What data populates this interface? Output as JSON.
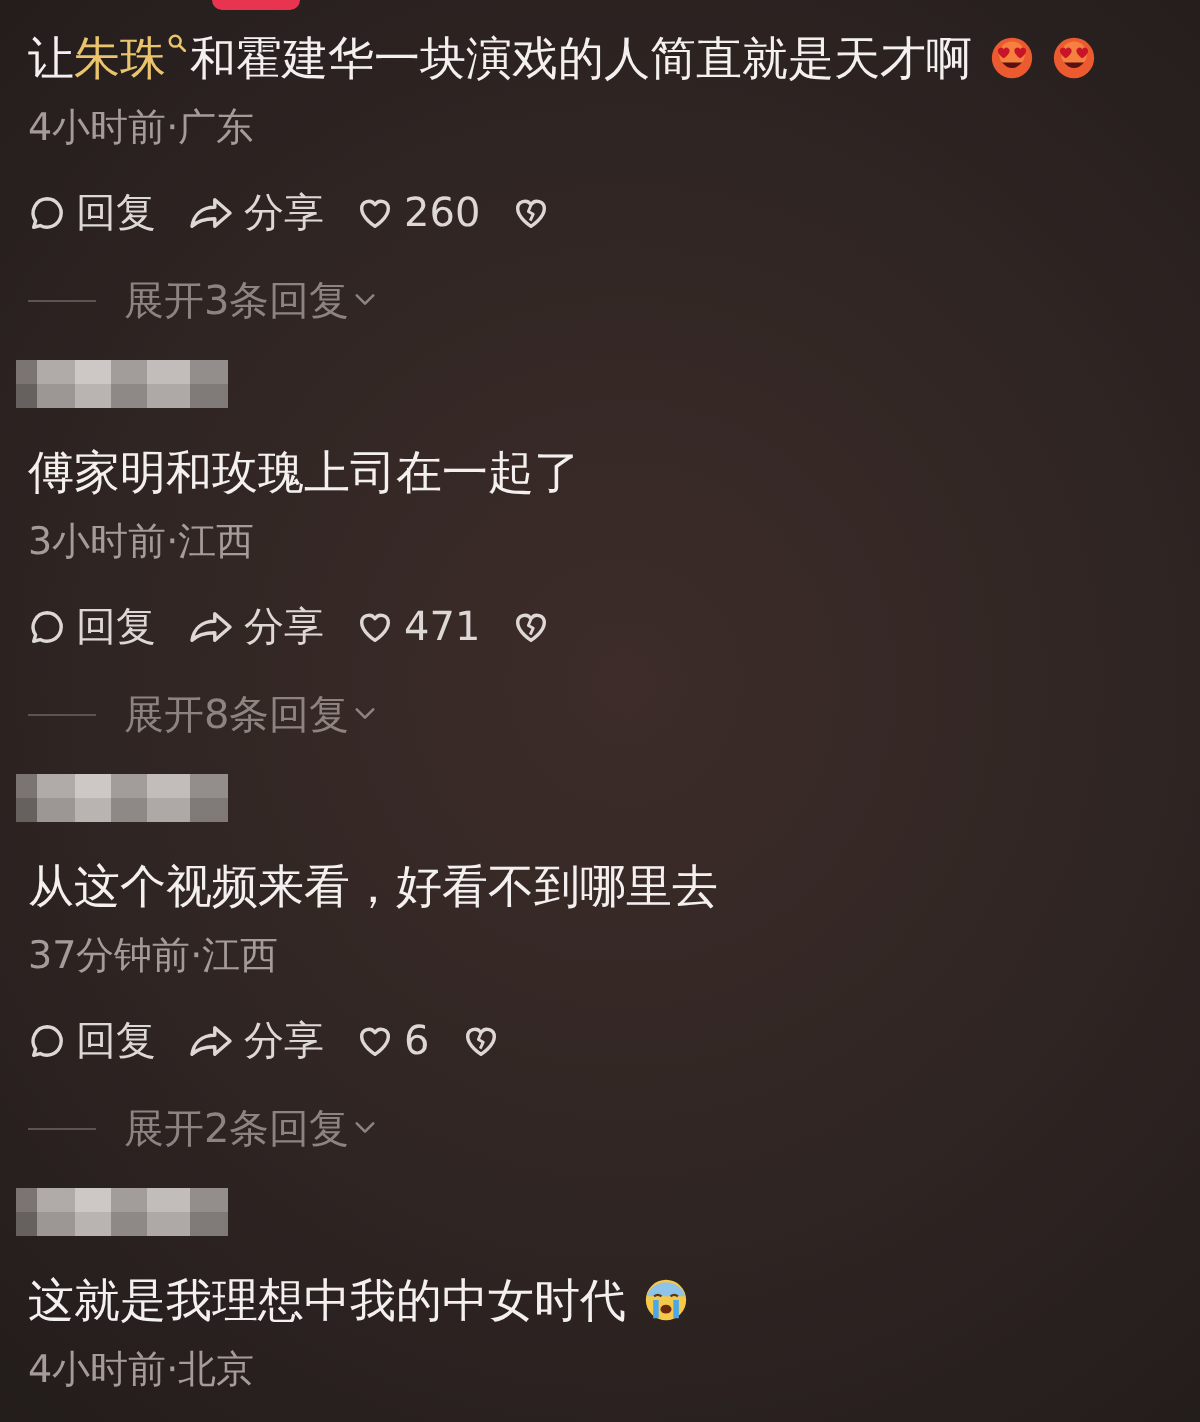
{
  "comments": [
    {
      "blurred_name": false,
      "text_parts": [
        {
          "kind": "plain",
          "text": "让"
        },
        {
          "kind": "keyword",
          "text": "朱珠"
        },
        {
          "kind": "plain",
          "text": "和霍建华一块演戏的人简直就是天才啊"
        }
      ],
      "emojis": [
        {
          "kind": "heart_eyes"
        },
        {
          "kind": "heart_eyes"
        }
      ],
      "meta": "4小时前·广东",
      "reply_label": "回复",
      "share_label": "分享",
      "likes": "260",
      "liked": false,
      "expand": "展开3条回复"
    },
    {
      "blurred_name": true,
      "text_parts": [
        {
          "kind": "plain",
          "text": "傅家明和玫瑰上司在一起了"
        }
      ],
      "meta": "3小时前·江西",
      "reply_label": "回复",
      "share_label": "分享",
      "likes": "471",
      "liked": false,
      "expand": "展开8条回复"
    },
    {
      "blurred_name": true,
      "text_parts": [
        {
          "kind": "plain",
          "text": "从这个视频来看，好看不到哪里去"
        }
      ],
      "meta": "37分钟前·江西",
      "reply_label": "回复",
      "share_label": "分享",
      "likes": "6",
      "liked": false,
      "expand": "展开2条回复"
    },
    {
      "blurred_name": true,
      "text_parts": [
        {
          "kind": "plain",
          "text": "这就是我理想中我的中女时代"
        }
      ],
      "emojis": [
        {
          "kind": "crying"
        }
      ],
      "meta": "4小时前·北京"
    }
  ]
}
